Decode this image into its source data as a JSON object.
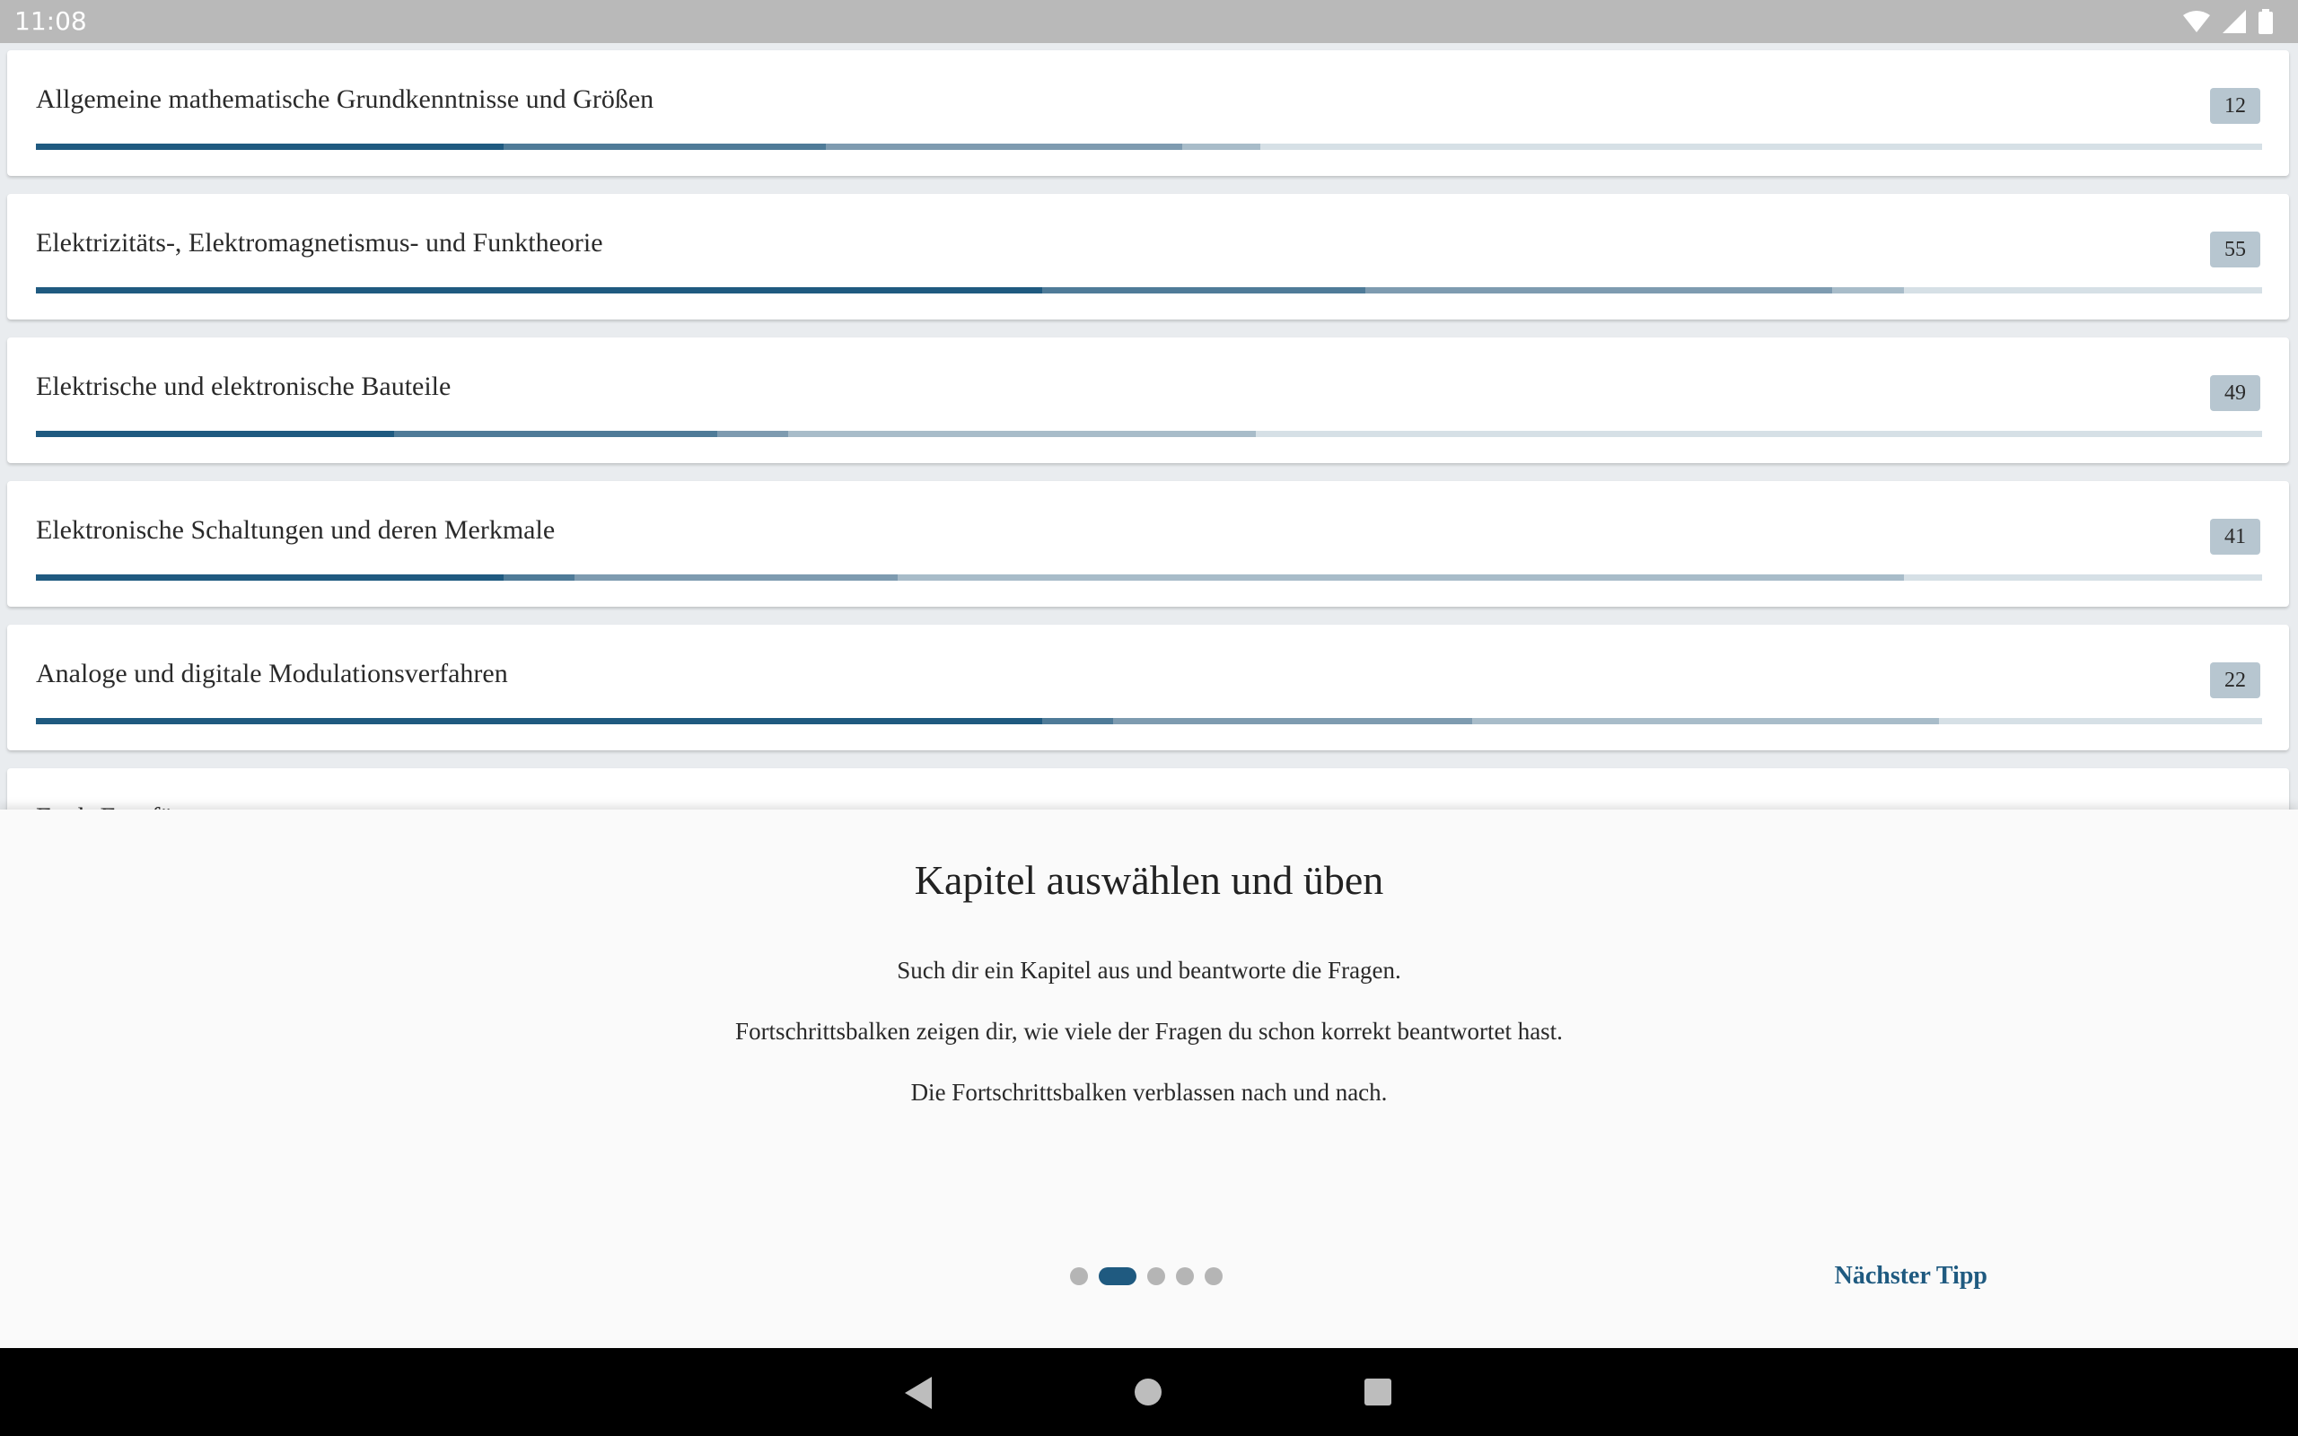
{
  "status_bar": {
    "time": "11:08",
    "icons": [
      "wifi-icon",
      "signal-icon",
      "battery-icon"
    ]
  },
  "colors": {
    "accent": "#1f5a80",
    "progress_level_1": "#1f5a80",
    "progress_level_2": "#4f7b98",
    "progress_level_3": "#7e9bb0",
    "progress_level_4": "#a8bcc9",
    "progress_track": "#d6e0e6",
    "badge": "#b7c6d0"
  },
  "chapters": [
    {
      "title": "Allgemeine mathematische Grundkenntnisse und Größen",
      "count": "12",
      "progress": [
        0.21,
        0.145,
        0.16,
        0.035
      ]
    },
    {
      "title": "Elektrizitäts-, Elektromagnetismus- und Funktheorie",
      "count": "55",
      "progress": [
        0.452,
        0.145,
        0.21,
        0.032
      ]
    },
    {
      "title": "Elektrische und elektronische Bauteile",
      "count": "49",
      "progress": [
        0.161,
        0.145,
        0.032,
        0.21
      ]
    },
    {
      "title": "Elektronische Schaltungen und deren Merkmale",
      "count": "41",
      "progress": [
        0.21,
        0.032,
        0.145,
        0.452
      ]
    },
    {
      "title": "Analoge und digitale Modulationsverfahren",
      "count": "22",
      "progress": [
        0.452,
        0.032,
        0.161,
        0.21
      ]
    },
    {
      "title": "Funk-Empfänger",
      "count": "",
      "progress": []
    }
  ],
  "tip": {
    "heading": "Kapitel auswählen und üben",
    "paragraphs": [
      "Such dir ein Kapitel aus und beantworte die Fragen.",
      "Fortschrittsbalken zeigen dir, wie viele der Fragen du schon korrekt beantwortet hast.",
      "Die Fortschrittsbalken verblassen nach und nach."
    ],
    "page_count": 5,
    "active_page": 2,
    "next_label": "Nächster Tipp"
  },
  "nav": {
    "icons": [
      "back-icon",
      "home-icon",
      "recents-icon"
    ]
  }
}
